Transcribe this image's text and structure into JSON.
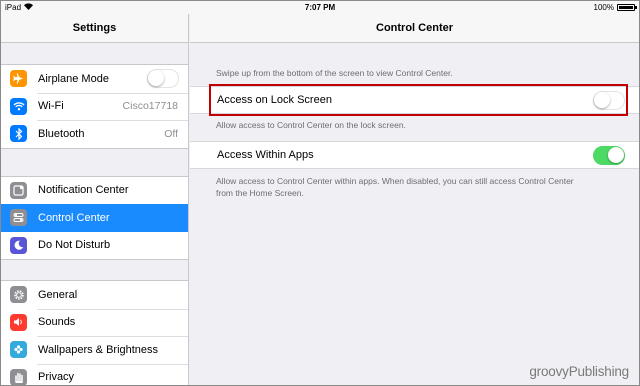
{
  "status_bar": {
    "device": "iPad",
    "time": "7:07 PM",
    "battery": "100%"
  },
  "sidebar": {
    "title": "Settings",
    "groups": [
      [
        {
          "label": "Airplane Mode",
          "icon": "airplane-icon",
          "color": "#ff9500",
          "switch": "off"
        },
        {
          "label": "Wi-Fi",
          "icon": "wifi-icon",
          "color": "#007aff",
          "value": "Cisco17718"
        },
        {
          "label": "Bluetooth",
          "icon": "bluetooth-icon",
          "color": "#007aff",
          "value": "Off"
        }
      ],
      [
        {
          "label": "Notification Center",
          "icon": "notification-center-icon",
          "color": "#8e8e93"
        },
        {
          "label": "Control Center",
          "icon": "control-center-icon",
          "color": "#8e8e93",
          "selected": true
        },
        {
          "label": "Do Not Disturb",
          "icon": "moon-icon",
          "color": "#5856d6"
        }
      ],
      [
        {
          "label": "General",
          "icon": "gear-icon",
          "color": "#8e8e93"
        },
        {
          "label": "Sounds",
          "icon": "speaker-icon",
          "color": "#ff3b30"
        },
        {
          "label": "Wallpapers & Brightness",
          "icon": "wallpaper-icon",
          "color": "#34aadc"
        },
        {
          "label": "Privacy",
          "icon": "hand-icon",
          "color": "#8e8e93"
        }
      ]
    ]
  },
  "main": {
    "title": "Control Center",
    "intro": "Swipe up from the bottom of the screen to view Control Center.",
    "lock_screen": {
      "label": "Access on Lock Screen",
      "state": "off",
      "footer": "Allow access to Control Center on the lock screen."
    },
    "within_apps": {
      "label": "Access Within Apps",
      "state": "on",
      "footer_line1": "Allow access to Control Center within apps. When disabled, you can still access Control Center",
      "footer_line2": "from the Home Screen."
    }
  },
  "colors": {
    "selected_row": "#1a8aff",
    "switch_on": "#4cd964",
    "highlight": "#c00000"
  },
  "watermark": "groovyPublishing"
}
